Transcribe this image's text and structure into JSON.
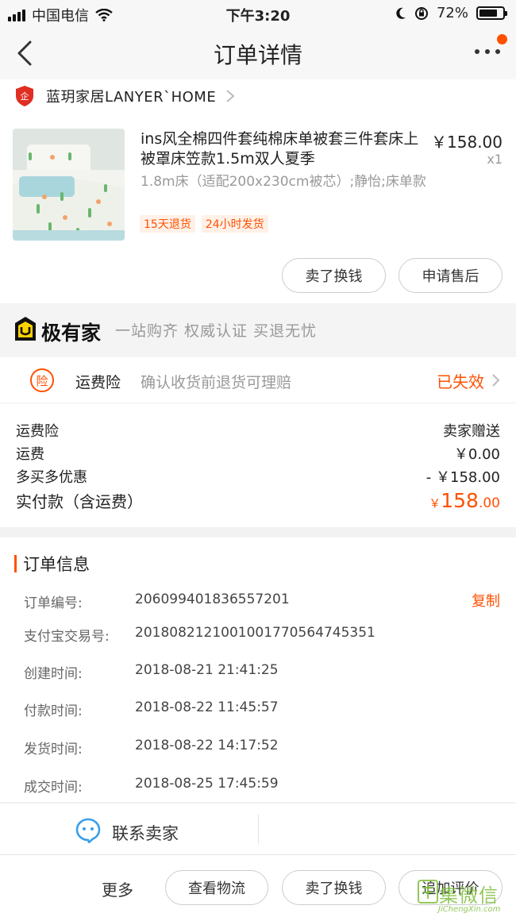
{
  "status_bar": {
    "carrier": "中国电信",
    "time": "下午3:20",
    "battery": "72%"
  },
  "nav": {
    "title": "订单详情",
    "has_notification_dot": true
  },
  "shop": {
    "name": "蓝玥家居LANYER`HOME",
    "icon": "shop-badge-icon"
  },
  "product": {
    "title": "ins风全棉四件套纯棉床单被套三件套床上被罩床笠款1.5m双人夏季",
    "price": "￥158.00",
    "quantity": "x1",
    "sku": "1.8m床（适配200x230cm被芯）;静怡;床单款",
    "tags": [
      "15天退货",
      "24小时发货"
    ],
    "actions": [
      "卖了换钱",
      "申请售后"
    ]
  },
  "banner": {
    "brand": "极有家",
    "slogan": "一站购齐 权威认证 买退无忧"
  },
  "insurance": {
    "badge": "险",
    "label": "运费险",
    "desc": "确认收货前退货可理赔",
    "status": "已失效"
  },
  "fees": [
    {
      "label": "运费险",
      "value": "卖家赠送"
    },
    {
      "label": "运费",
      "value": "￥0.00"
    },
    {
      "label": "多买多优惠",
      "value": "- ￥158.00"
    }
  ],
  "total": {
    "label": "实付款（含运费）",
    "currency": "￥",
    "integer": "158",
    "decimal": ".00"
  },
  "order_info": {
    "title": "订单信息",
    "copy_label": "复制",
    "rows": [
      {
        "label": "订单编号:",
        "value": "206099401836557201"
      },
      {
        "label": "支付宝交易号:",
        "value": "2018082121001001770564745351"
      },
      {
        "label": "创建时间:",
        "value": "2018-08-21 21:41:25"
      },
      {
        "label": "付款时间:",
        "value": "2018-08-22 11:45:57"
      },
      {
        "label": "发货时间:",
        "value": "2018-08-22 14:17:52"
      },
      {
        "label": "成交时间:",
        "value": "2018-08-25 17:45:59"
      }
    ]
  },
  "contact": {
    "label": "联系卖家"
  },
  "bottom_bar": {
    "more": "更多",
    "buttons": [
      "查看物流",
      "卖了换钱",
      "追加评价"
    ]
  },
  "watermark": {
    "text": "集微信",
    "sub": "JiChengXin.com"
  },
  "colors": {
    "accent": "#ff5000",
    "contact_icon": "#3aa0e8"
  }
}
